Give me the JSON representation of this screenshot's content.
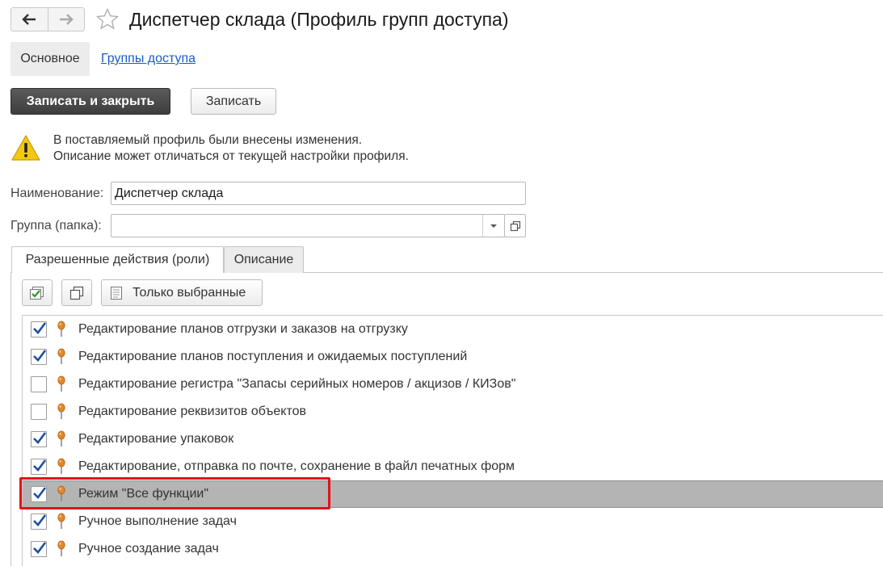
{
  "window": {
    "title": "Диспетчер склада (Профиль групп доступа)",
    "back_icon": "arrow-left-icon",
    "forward_icon": "arrow-right-icon",
    "favorite_icon": "star-icon"
  },
  "sections": {
    "main_label": "Основное",
    "access_groups_link": "Группы доступа"
  },
  "toolbar": {
    "save_close_label": "Записать и закрыть",
    "save_label": "Записать"
  },
  "warning": {
    "line1": "В поставляемый профиль были внесены изменения.",
    "line2": "Описание может отличаться от текущей настройки профиля."
  },
  "form": {
    "name_label": "Наименование:",
    "name_value": "Диспетчер склада",
    "group_label": "Группа (папка):",
    "group_value": ""
  },
  "tabs": [
    {
      "label": "Разрешенные действия (роли)",
      "active": true
    },
    {
      "label": "Описание",
      "active": false
    }
  ],
  "roles_toolbar": {
    "check_all_icon": "check-all-icon",
    "copy_icon": "copy-icon",
    "only_selected_label": "Только выбранные"
  },
  "roles": [
    {
      "label": "Редактирование планов отгрузки и заказов на отгрузку",
      "checked": true
    },
    {
      "label": "Редактирование планов поступления и ожидаемых поступлений",
      "checked": true
    },
    {
      "label": "Редактирование регистра \"Запасы серийных номеров / акцизов / КИЗов\"",
      "checked": false
    },
    {
      "label": "Редактирование реквизитов объектов",
      "checked": false
    },
    {
      "label": "Редактирование упаковок",
      "checked": true
    },
    {
      "label": "Редактирование, отправка по почте, сохранение в файл печатных форм",
      "checked": true
    },
    {
      "label": "Режим \"Все функции\"",
      "checked": true,
      "selected": true
    },
    {
      "label": "Ручное выполнение задач",
      "checked": true
    },
    {
      "label": "Ручное создание задач",
      "checked": true
    }
  ],
  "colors": {
    "accent_link": "#1d5bbf",
    "primary_button": "#4a4a4a",
    "highlight_border": "#e0131b",
    "selected_row": "#b4b4b4",
    "checkmark": "#1e4f9c",
    "pin": "#e0882a"
  }
}
